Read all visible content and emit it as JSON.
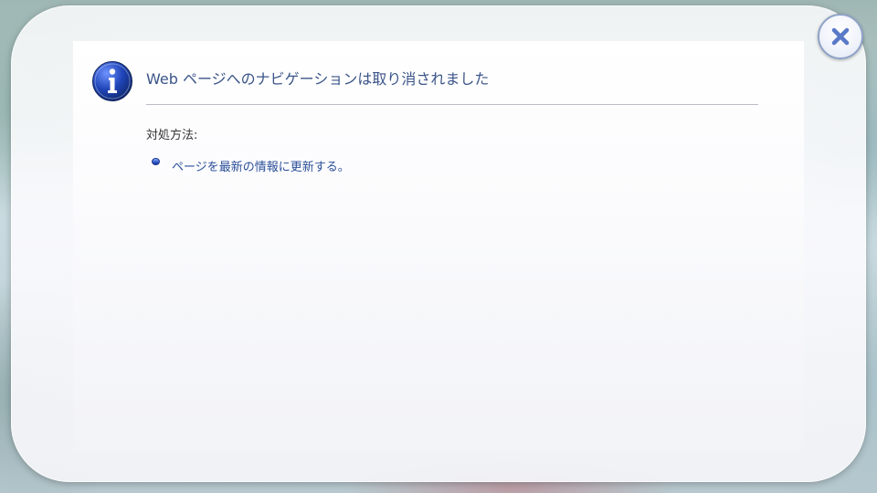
{
  "dialog": {
    "heading": "Web ページへのナビゲーションは取り消されました",
    "remedy_label": "対処方法:",
    "remedy_items": [
      {
        "label": "ページを最新の情報に更新する。"
      }
    ]
  },
  "icons": {
    "info": "info-icon",
    "close": "close-icon",
    "bullet": "bullet-icon"
  },
  "colors": {
    "heading_text": "#3a5488",
    "link_text": "#2b4f99",
    "info_icon_blue": "#1f45b8",
    "close_x": "#5a79c8"
  }
}
